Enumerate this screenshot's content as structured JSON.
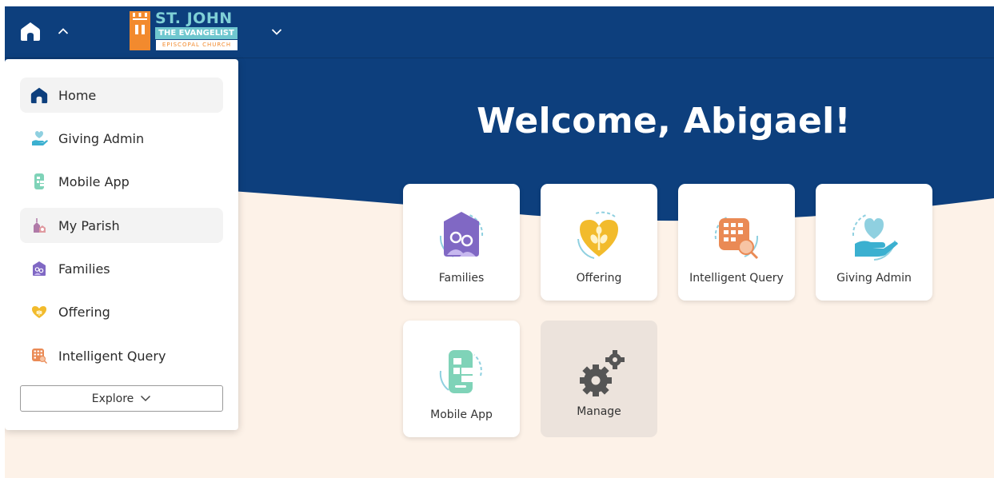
{
  "header": {
    "logo": {
      "line1": "ST. JOHN",
      "line2": "THE EVANGELIST",
      "line3": "EPISCOPAL CHURCH"
    }
  },
  "welcome": "Welcome, Abigael!",
  "menu": {
    "items": [
      {
        "label": "Home",
        "icon": "home-icon"
      },
      {
        "label": "Giving Admin",
        "icon": "giving-admin-icon"
      },
      {
        "label": "Mobile App",
        "icon": "mobile-app-icon"
      },
      {
        "label": "My Parish",
        "icon": "my-parish-icon"
      },
      {
        "label": "Families",
        "icon": "families-icon"
      },
      {
        "label": "Offering",
        "icon": "offering-icon"
      },
      {
        "label": "Intelligent Query",
        "icon": "intelligent-query-icon"
      }
    ],
    "explore_label": "Explore"
  },
  "tiles": [
    {
      "label": "Families",
      "icon": "families-icon"
    },
    {
      "label": "Offering",
      "icon": "offering-icon"
    },
    {
      "label": "Intelligent Query",
      "icon": "intelligent-query-icon"
    },
    {
      "label": "Giving Admin",
      "icon": "giving-admin-icon"
    },
    {
      "label": "Mobile App",
      "icon": "mobile-app-icon"
    },
    {
      "label": "Manage",
      "icon": "gears-icon"
    }
  ],
  "colors": {
    "header_blue": "#0d3f7d",
    "page_background": "#fdf2e8",
    "logo_orange": "#f28a2e",
    "logo_teal": "#6fc7cf"
  }
}
